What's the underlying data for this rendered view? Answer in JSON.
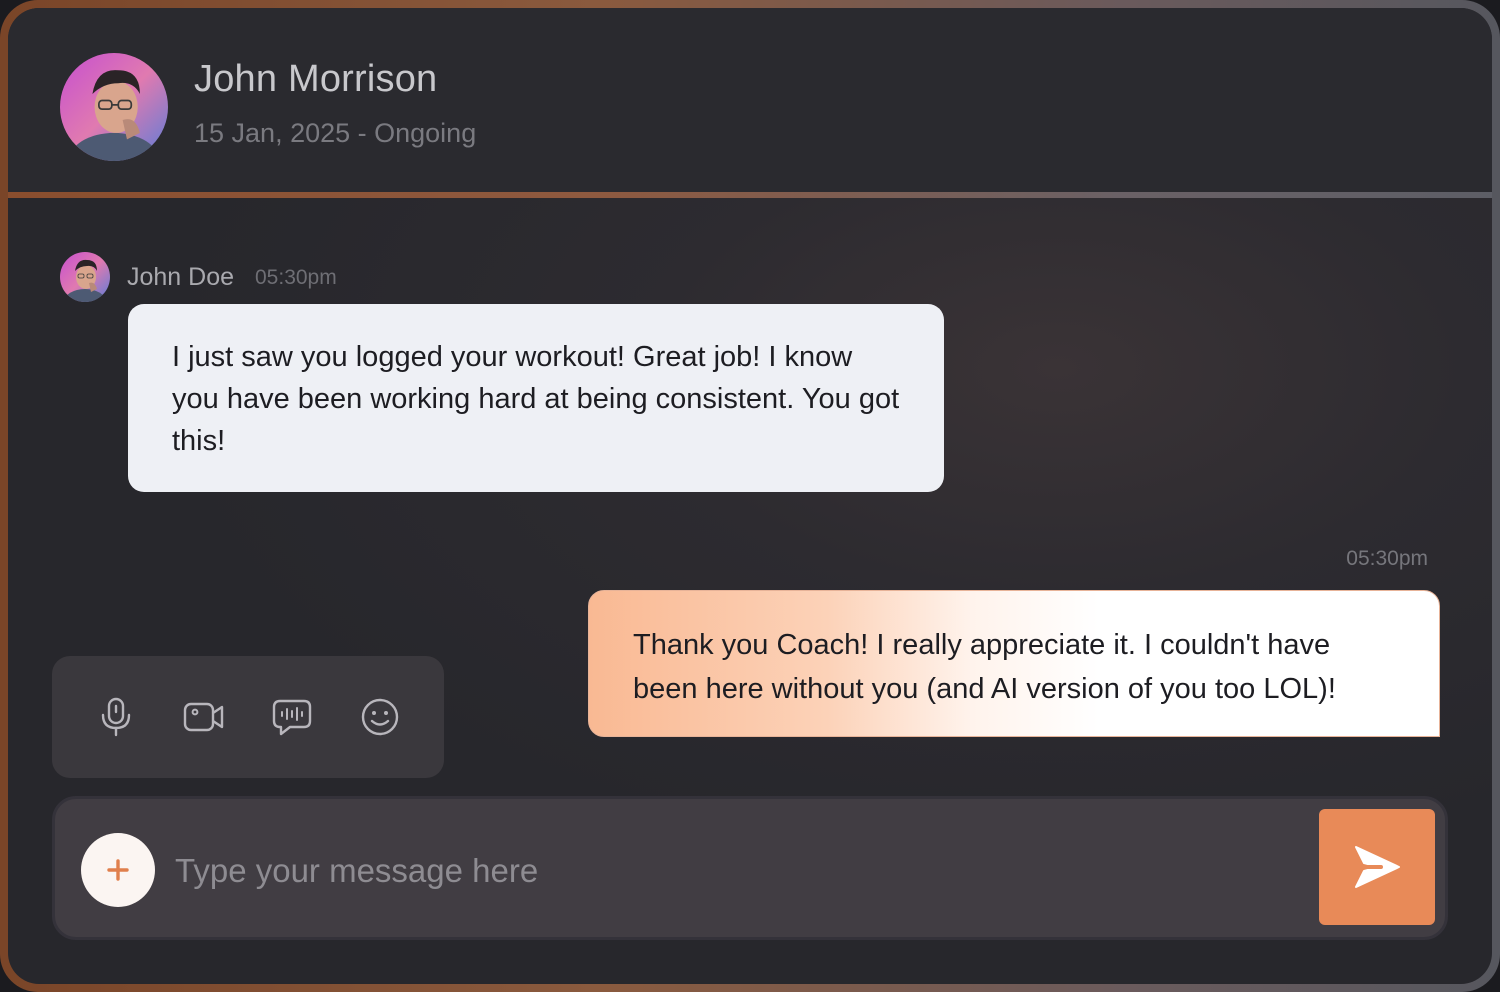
{
  "header": {
    "name": "John Morrison",
    "subtitle": "15 Jan, 2025 - Ongoing"
  },
  "incoming": {
    "sender": "John Doe",
    "time": "05:30pm",
    "text": "I just saw you logged your workout! Great job! I know you have been working hard at being consistent. You got this!"
  },
  "outgoing": {
    "time": "05:30pm",
    "text": "Thank you Coach! I really appreciate it. I couldn't have been here without you (and AI version of you too LOL)!"
  },
  "tools": [
    {
      "icon": "microphone-icon"
    },
    {
      "icon": "video-camera-icon"
    },
    {
      "icon": "voice-message-icon"
    },
    {
      "icon": "emoji-icon"
    }
  ],
  "composer": {
    "placeholder": "Type your message here",
    "add_icon": "plus-icon",
    "send_icon": "send-icon"
  },
  "colors": {
    "accent": "#e88a58",
    "incoming_bubble": "#eef0f5",
    "background": "#2a2a2f"
  }
}
